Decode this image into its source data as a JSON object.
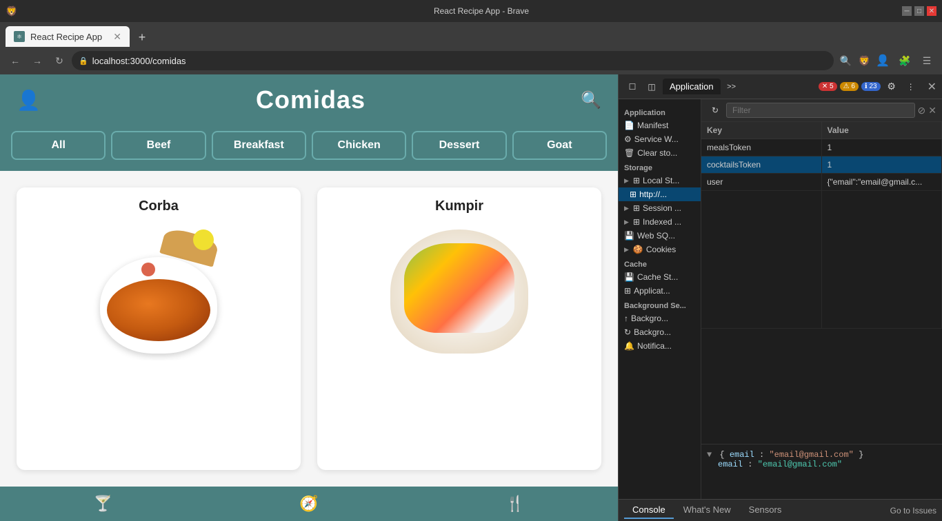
{
  "browser": {
    "title": "React Recipe App - Brave",
    "tab_label": "React Recipe App",
    "address": "localhost:3000/comidas"
  },
  "app": {
    "title": "Comidas",
    "categories": [
      "All",
      "Beef",
      "Breakfast",
      "Chicken",
      "Dessert",
      "Goat"
    ],
    "recipes": [
      {
        "name": "Corba",
        "type": "soup"
      },
      {
        "name": "Kumpir",
        "type": "kumpir"
      }
    ],
    "bottom_nav": [
      "cocktail-icon",
      "compass-icon",
      "utensils-icon"
    ]
  },
  "devtools": {
    "active_panel": "Application",
    "panels": [
      "Application"
    ],
    "more_panels": ">>",
    "errors": "5",
    "warnings": "6",
    "info": "23",
    "filter_placeholder": "Filter",
    "sidebar": {
      "application_section": "Application",
      "items": [
        {
          "label": "Manifest",
          "icon": "📄",
          "indent": 0
        },
        {
          "label": "Service W...",
          "icon": "⚙",
          "indent": 0
        },
        {
          "label": "Clear sto...",
          "icon": "🗑",
          "indent": 0
        }
      ],
      "storage_section": "Storage",
      "storage_items": [
        {
          "label": "Local St...",
          "icon": "▶",
          "has_arrow": true
        },
        {
          "label": "http://...",
          "icon": "",
          "indent": 1,
          "selected": true
        },
        {
          "label": "Session ...",
          "icon": "▶",
          "has_arrow": true
        },
        {
          "label": "Indexed ...",
          "icon": "▶",
          "has_arrow": true
        },
        {
          "label": "Web SQ...",
          "icon": "",
          "indent": 0
        },
        {
          "label": "Cookies",
          "icon": "▶",
          "has_arrow": true
        }
      ],
      "cache_section": "Cache",
      "cache_items": [
        {
          "label": "Cache St...",
          "icon": ""
        },
        {
          "label": "Applicat...",
          "icon": ""
        }
      ],
      "background_section": "Background Se...",
      "bg_items": [
        {
          "label": "Backgro...",
          "icon": "↑"
        },
        {
          "label": "Backgro...",
          "icon": "↻"
        },
        {
          "label": "Notifica...",
          "icon": "🔔"
        }
      ]
    },
    "table": {
      "columns": [
        "Key",
        "Value"
      ],
      "rows": [
        {
          "key": "mealsToken",
          "value": "1",
          "selected": false
        },
        {
          "key": "cocktailsToken",
          "value": "1",
          "selected": true
        },
        {
          "key": "user",
          "value": "{\"email\":\"email@gmail.c...",
          "selected": false
        }
      ]
    },
    "json_preview": {
      "brace_open": "{email: \"email@gmail.com\"}",
      "key": "email",
      "value": "\"email@gmail.com\""
    },
    "bottom_tabs": [
      "Console",
      "What's New",
      "Sensors"
    ],
    "active_bottom_tab": "Console",
    "issues_label": "Go to Issues"
  }
}
